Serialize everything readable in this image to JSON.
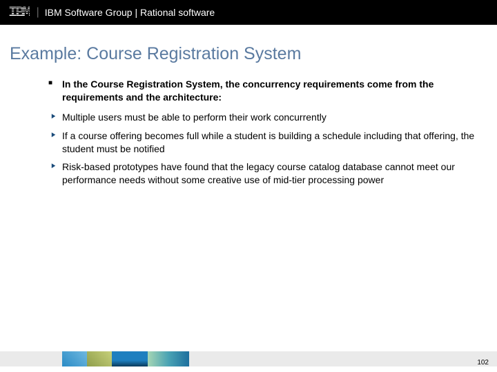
{
  "header": {
    "logo": "IBM",
    "text": "IBM Software Group | Rational software"
  },
  "title": "Example: Course Registration System",
  "lead": "In the Course Registration System, the concurrency requirements come from the requirements and the architecture:",
  "subs": [
    "Multiple users must be able to perform their work concurrently",
    "If a course offering becomes full while a student is building a schedule including that offering, the student must be notified",
    "Risk-based prototypes have found that the legacy course catalog database cannot meet our performance needs without some creative use of mid-tier processing power"
  ],
  "page": "102"
}
